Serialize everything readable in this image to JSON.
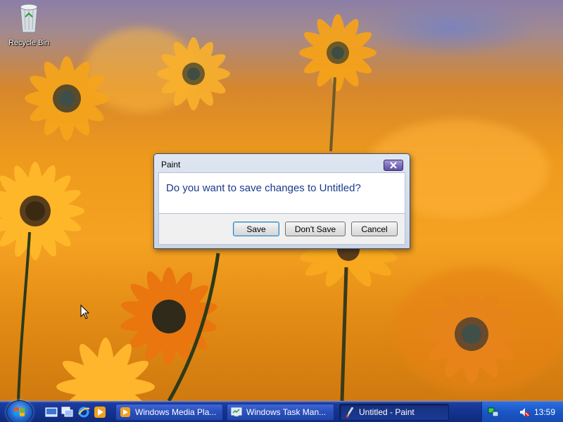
{
  "desktop": {
    "icons": [
      {
        "label": "Recycle Bin",
        "icon": "recycle-bin-icon"
      }
    ],
    "wallpaper": "orange-daisies"
  },
  "dialog": {
    "title": "Paint",
    "message": "Do you want to save changes to Untitled?",
    "buttons": {
      "save": "Save",
      "dont_save": "Don't Save",
      "cancel": "Cancel"
    },
    "close_icon": "close-icon"
  },
  "taskbar": {
    "start_icon": "windows-logo-icon",
    "quick_launch": [
      "show-desktop-icon",
      "switch-windows-icon",
      "internet-explorer-icon",
      "media-player-icon"
    ],
    "tasks": [
      {
        "label": "Windows Media Pla...",
        "icon": "media-player-icon",
        "active": false
      },
      {
        "label": "Windows Task Man...",
        "icon": "task-manager-icon",
        "active": false
      },
      {
        "label": "Untitled - Paint",
        "icon": "paint-icon",
        "active": true
      }
    ],
    "tray": {
      "icons": [
        "network-icon",
        "volume-muted-icon"
      ],
      "clock": "13:59"
    }
  },
  "colors": {
    "taskbar": "#14338f",
    "dialog_message": "#1a3a8c",
    "wallpaper_orange": "#f5a222"
  }
}
